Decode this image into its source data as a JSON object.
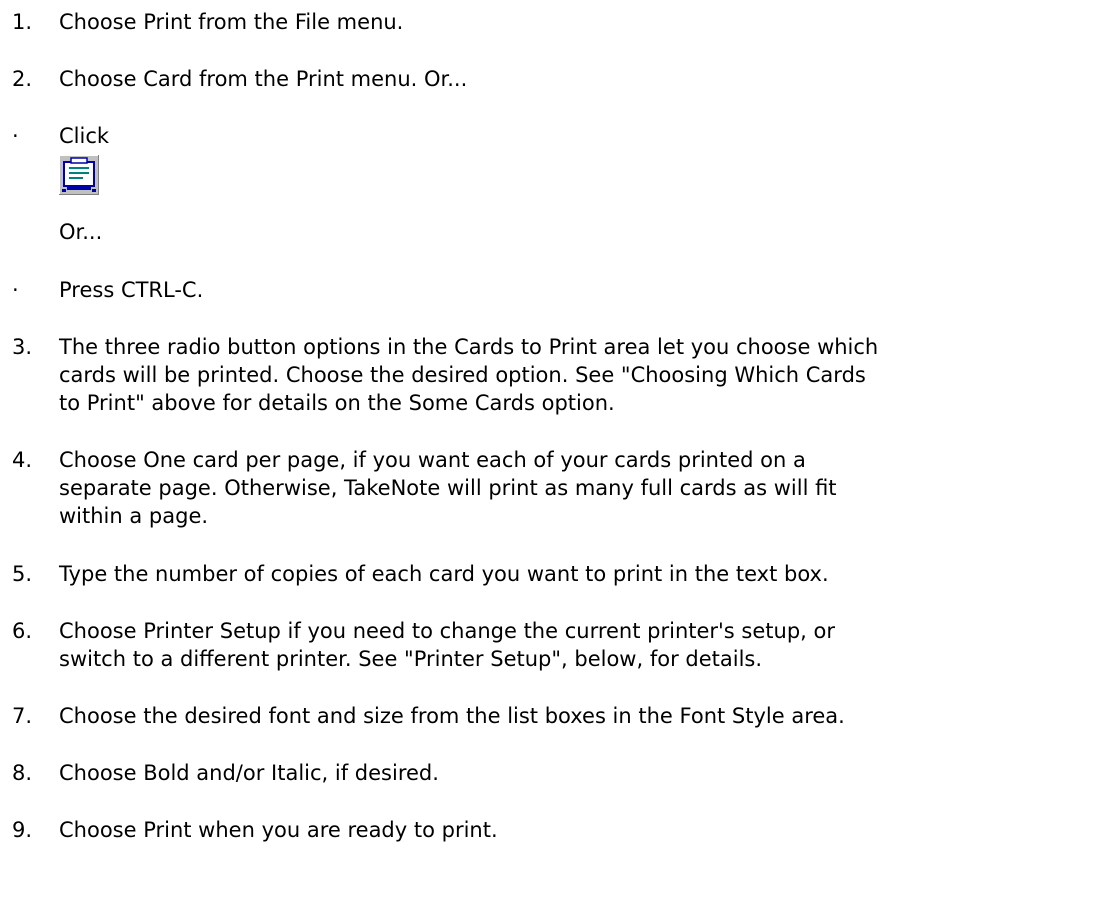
{
  "steps": [
    {
      "num": "1.",
      "lines": [
        "Choose Print from the File menu."
      ]
    },
    {
      "num": "2.",
      "lines": [
        "Choose Card from the Print menu. Or..."
      ]
    },
    {
      "bullet": "·",
      "lines": [
        "Click"
      ]
    },
    {
      "lines": [
        "Or..."
      ]
    },
    {
      "bullet": "·",
      "lines": [
        "Press CTRL-C."
      ]
    },
    {
      "num": "3.",
      "lines": [
        "The three radio button options in the Cards to Print area let you choose which",
        "cards will be printed. Choose the desired option. See \"Choosing Which Cards",
        "to Print\" above for details on the Some Cards option."
      ]
    },
    {
      "num": "4.",
      "lines": [
        "Choose One card per page, if you want each of your cards printed on a",
        "separate page. Otherwise, TakeNote will print as many full cards as will fit",
        "within a page."
      ]
    },
    {
      "num": "5.",
      "lines": [
        "Type the number of copies of each card you want to print in the text box."
      ]
    },
    {
      "num": "6.",
      "lines": [
        "Choose Printer Setup if you need to change the current printer's setup, or",
        "switch to a different printer. See \"Printer Setup\", below, for details."
      ]
    },
    {
      "num": "7.",
      "lines": [
        "Choose the desired font and size from the list boxes in the Font Style area."
      ]
    },
    {
      "num": "8.",
      "lines": [
        "Choose Bold and/or Italic, if desired."
      ]
    },
    {
      "num": "9.",
      "lines": [
        "Choose Print when you are ready to print."
      ]
    }
  ],
  "toolbar_icon": "print-card-icon"
}
